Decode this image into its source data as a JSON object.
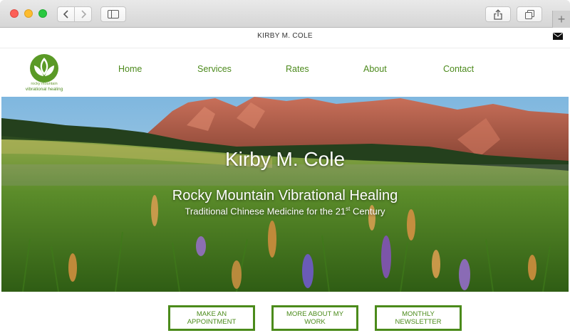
{
  "browser": {
    "icons": [
      "back-chevron-icon",
      "forward-chevron-icon",
      "sidebar-icon",
      "share-icon",
      "tabs-icon",
      "plus-icon"
    ]
  },
  "topbar": {
    "site_name": "KIRBY M. COLE",
    "mail_icon": "envelope-icon"
  },
  "logo": {
    "line1": "rocky mountain",
    "line2": "vibrational healing",
    "color": "#5a9a26"
  },
  "nav": {
    "items": [
      {
        "label": "Home"
      },
      {
        "label": "Services"
      },
      {
        "label": "Rates"
      },
      {
        "label": "About"
      },
      {
        "label": "Contact"
      }
    ]
  },
  "hero": {
    "title": "Kirby M. Cole",
    "subtitle": "Rocky Mountain Vibrational Healing",
    "tagline_prefix": "Traditional Chinese Medicine for the 21",
    "tagline_sup": "st",
    "tagline_suffix": " Century"
  },
  "cta": {
    "appointment": "MAKE AN APPOINTMENT",
    "more_work": "MORE ABOUT MY WORK",
    "newsletter": "MONTHLY NEWSLETTER"
  },
  "colors": {
    "accent": "#4b8b1b",
    "nav_text": "#4c8a1c"
  }
}
